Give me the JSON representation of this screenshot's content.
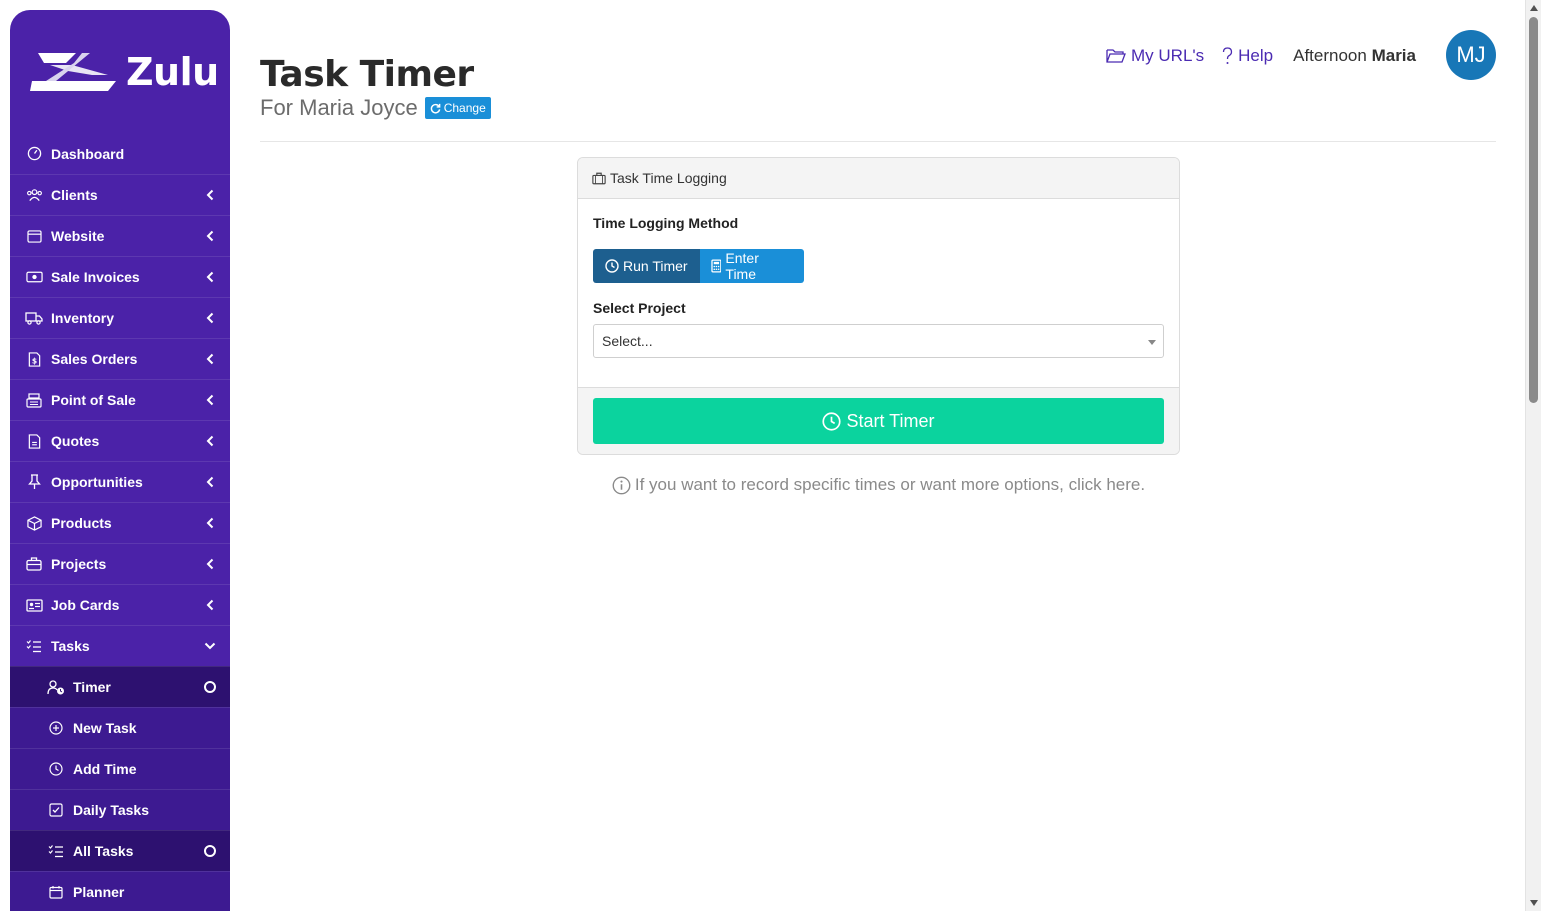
{
  "brand": {
    "name": "Zulu"
  },
  "sidebar": {
    "items": [
      {
        "label": "Dashboard",
        "icon": "dashboard-icon",
        "chevron": ""
      },
      {
        "label": "Clients",
        "icon": "users-icon",
        "chevron": "left"
      },
      {
        "label": "Website",
        "icon": "browser-icon",
        "chevron": "left"
      },
      {
        "label": "Sale Invoices",
        "icon": "money-icon",
        "chevron": "left"
      },
      {
        "label": "Inventory",
        "icon": "truck-icon",
        "chevron": "left"
      },
      {
        "label": "Sales Orders",
        "icon": "document-dollar-icon",
        "chevron": "left"
      },
      {
        "label": "Point of Sale",
        "icon": "register-icon",
        "chevron": "left"
      },
      {
        "label": "Quotes",
        "icon": "document-icon",
        "chevron": "left"
      },
      {
        "label": "Opportunities",
        "icon": "pin-icon",
        "chevron": "left"
      },
      {
        "label": "Products",
        "icon": "box-icon",
        "chevron": "left"
      },
      {
        "label": "Projects",
        "icon": "briefcase-icon",
        "chevron": "left"
      },
      {
        "label": "Job Cards",
        "icon": "id-card-icon",
        "chevron": "left"
      },
      {
        "label": "Tasks",
        "icon": "task-list-icon",
        "chevron": "down"
      }
    ],
    "subitems": [
      {
        "label": "Timer",
        "icon": "user-clock-icon"
      },
      {
        "label": "New Task",
        "icon": "plus-circle-icon"
      },
      {
        "label": "Add Time",
        "icon": "clock-icon"
      },
      {
        "label": "Daily Tasks",
        "icon": "check-square-icon"
      },
      {
        "label": "All Tasks",
        "icon": "task-list-icon"
      },
      {
        "label": "Planner",
        "icon": "calendar-icon"
      }
    ]
  },
  "header": {
    "my_urls": "My URL's",
    "help": "Help",
    "greeting_prefix": "Afternoon",
    "greeting_name": "Maria",
    "avatar_initials": "MJ"
  },
  "page": {
    "title": "Task Timer",
    "subtitle": "For Maria Joyce",
    "change_label": "Change"
  },
  "card": {
    "header": "Task Time Logging",
    "method_label": "Time Logging Method",
    "run_timer": "Run Timer",
    "enter_time": "Enter Time",
    "project_label": "Select Project",
    "project_placeholder": "Select...",
    "start_button": "Start Timer"
  },
  "hint": "If you want to record specific times or want more options, click here.",
  "colors": {
    "sidebar": "#4b22a8",
    "sidebar_sub": "#3d1a91",
    "sidebar_active": "#2d1170",
    "link": "#4b2bb2",
    "avatar": "#1877b7",
    "primary": "#1a8fd8",
    "primary_dark": "#1d5f8f",
    "success": "#0bd39e"
  }
}
